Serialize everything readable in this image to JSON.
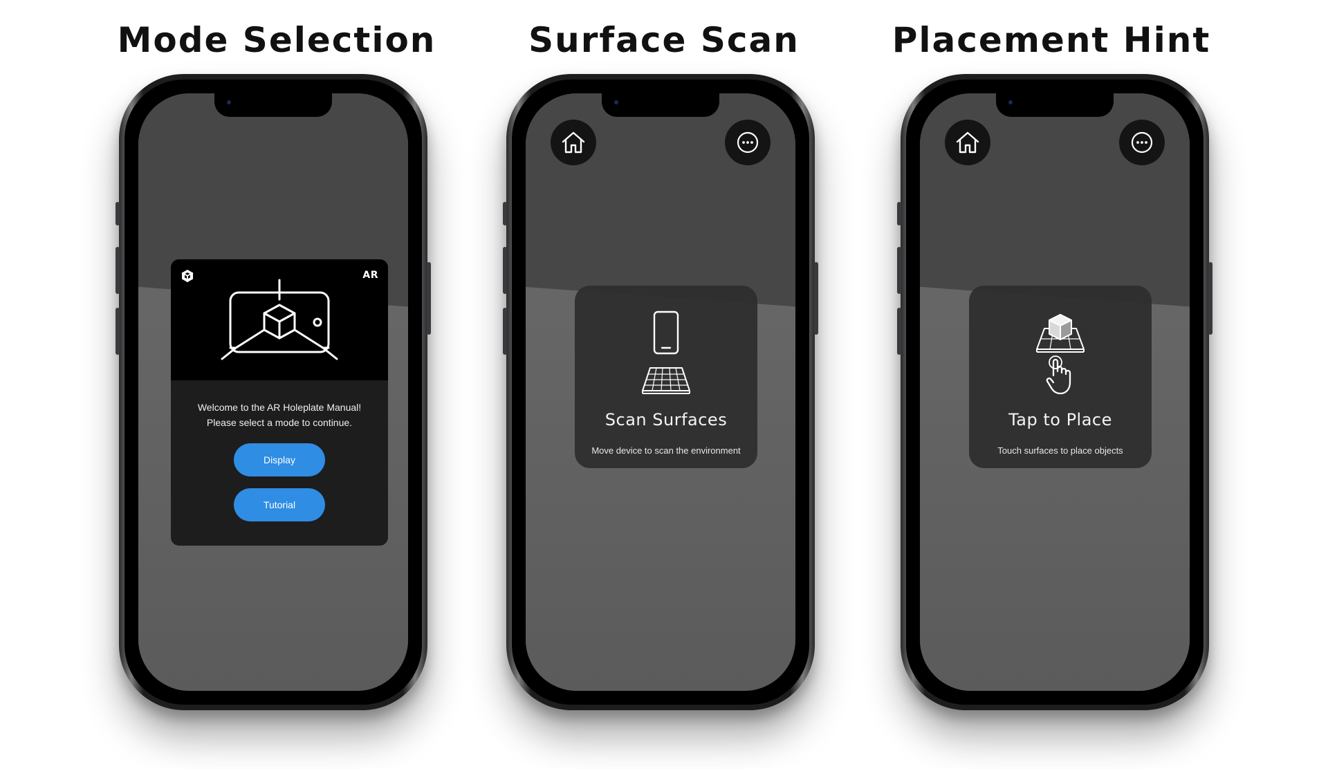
{
  "columns": {
    "mode": {
      "title": "Mode Selection"
    },
    "scan": {
      "title": "Surface Scan"
    },
    "place": {
      "title": "Placement Hint"
    }
  },
  "mode_dialog": {
    "badge": "AR",
    "welcome_line1": "Welcome to the AR Holeplate Manual!",
    "welcome_line2": "Please select a mode to continue.",
    "display_button": "Display",
    "tutorial_button": "Tutorial",
    "button_color": "#2f8de4"
  },
  "scan_hint": {
    "title": "Scan Surfaces",
    "subtitle": "Move device to scan the environment"
  },
  "place_hint": {
    "title": "Tap to Place",
    "subtitle": "Touch surfaces to place objects"
  },
  "icons": {
    "home": "home-icon",
    "more": "more-options-icon",
    "phone": "phone-icon",
    "grid_surface": "grid-surface-icon",
    "cube_on_plane": "cube-on-plane-icon",
    "tap_hand": "tap-hand-icon",
    "unity_logo": "unity-logo-icon",
    "ar_phone_cube": "ar-phone-cube-icon"
  }
}
